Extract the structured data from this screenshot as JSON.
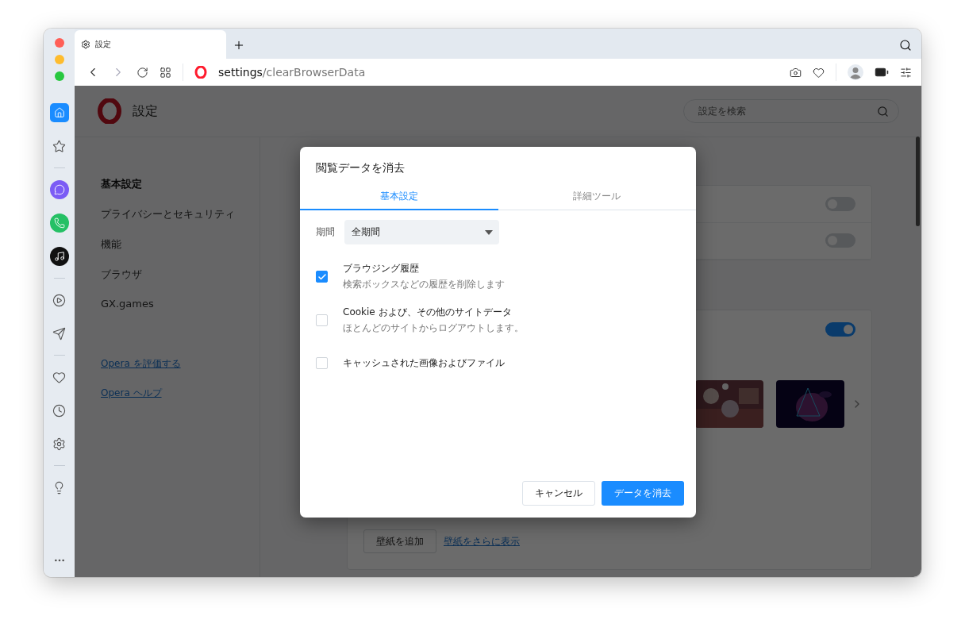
{
  "browser": {
    "tab": {
      "title": "設定"
    },
    "address": {
      "host": "settings",
      "path": "/clearBrowserData"
    }
  },
  "settings_page": {
    "title": "設定",
    "search": {
      "placeholder": "設定を検索"
    },
    "nav": [
      {
        "label": "基本設定",
        "selected": true
      },
      {
        "label": "プライバシーとセキュリティ",
        "selected": false
      },
      {
        "label": "機能",
        "selected": false
      },
      {
        "label": "ブラウザ",
        "selected": false
      },
      {
        "label": "GX.games",
        "selected": false
      }
    ],
    "links": [
      "Opera を評価する",
      "Opera ヘルプ"
    ],
    "option_card": {
      "toggles": [
        {
          "on": false
        },
        {
          "on": false
        }
      ]
    },
    "wallpaper_card": {
      "toggle": {
        "on": true
      },
      "add_button": "壁紙を追加",
      "more_link": "壁紙をさらに表示"
    }
  },
  "dialog": {
    "title": "閲覧データを消去",
    "tabs": [
      {
        "label": "基本設定",
        "selected": true
      },
      {
        "label": "詳細ツール",
        "selected": false
      }
    ],
    "period": {
      "label": "期間",
      "value": "全期間"
    },
    "items": [
      {
        "label": "ブラウジング履歴",
        "description": "検索ボックスなどの履歴を削除します",
        "checked": true
      },
      {
        "label": "Cookie および、その他のサイトデータ",
        "description": "ほとんどのサイトからログアウトします。",
        "checked": false
      },
      {
        "label": "キャッシュされた画像およびファイル",
        "checked": false
      }
    ],
    "cancel_button": "キャンセル",
    "confirm_button": "データを消去"
  }
}
